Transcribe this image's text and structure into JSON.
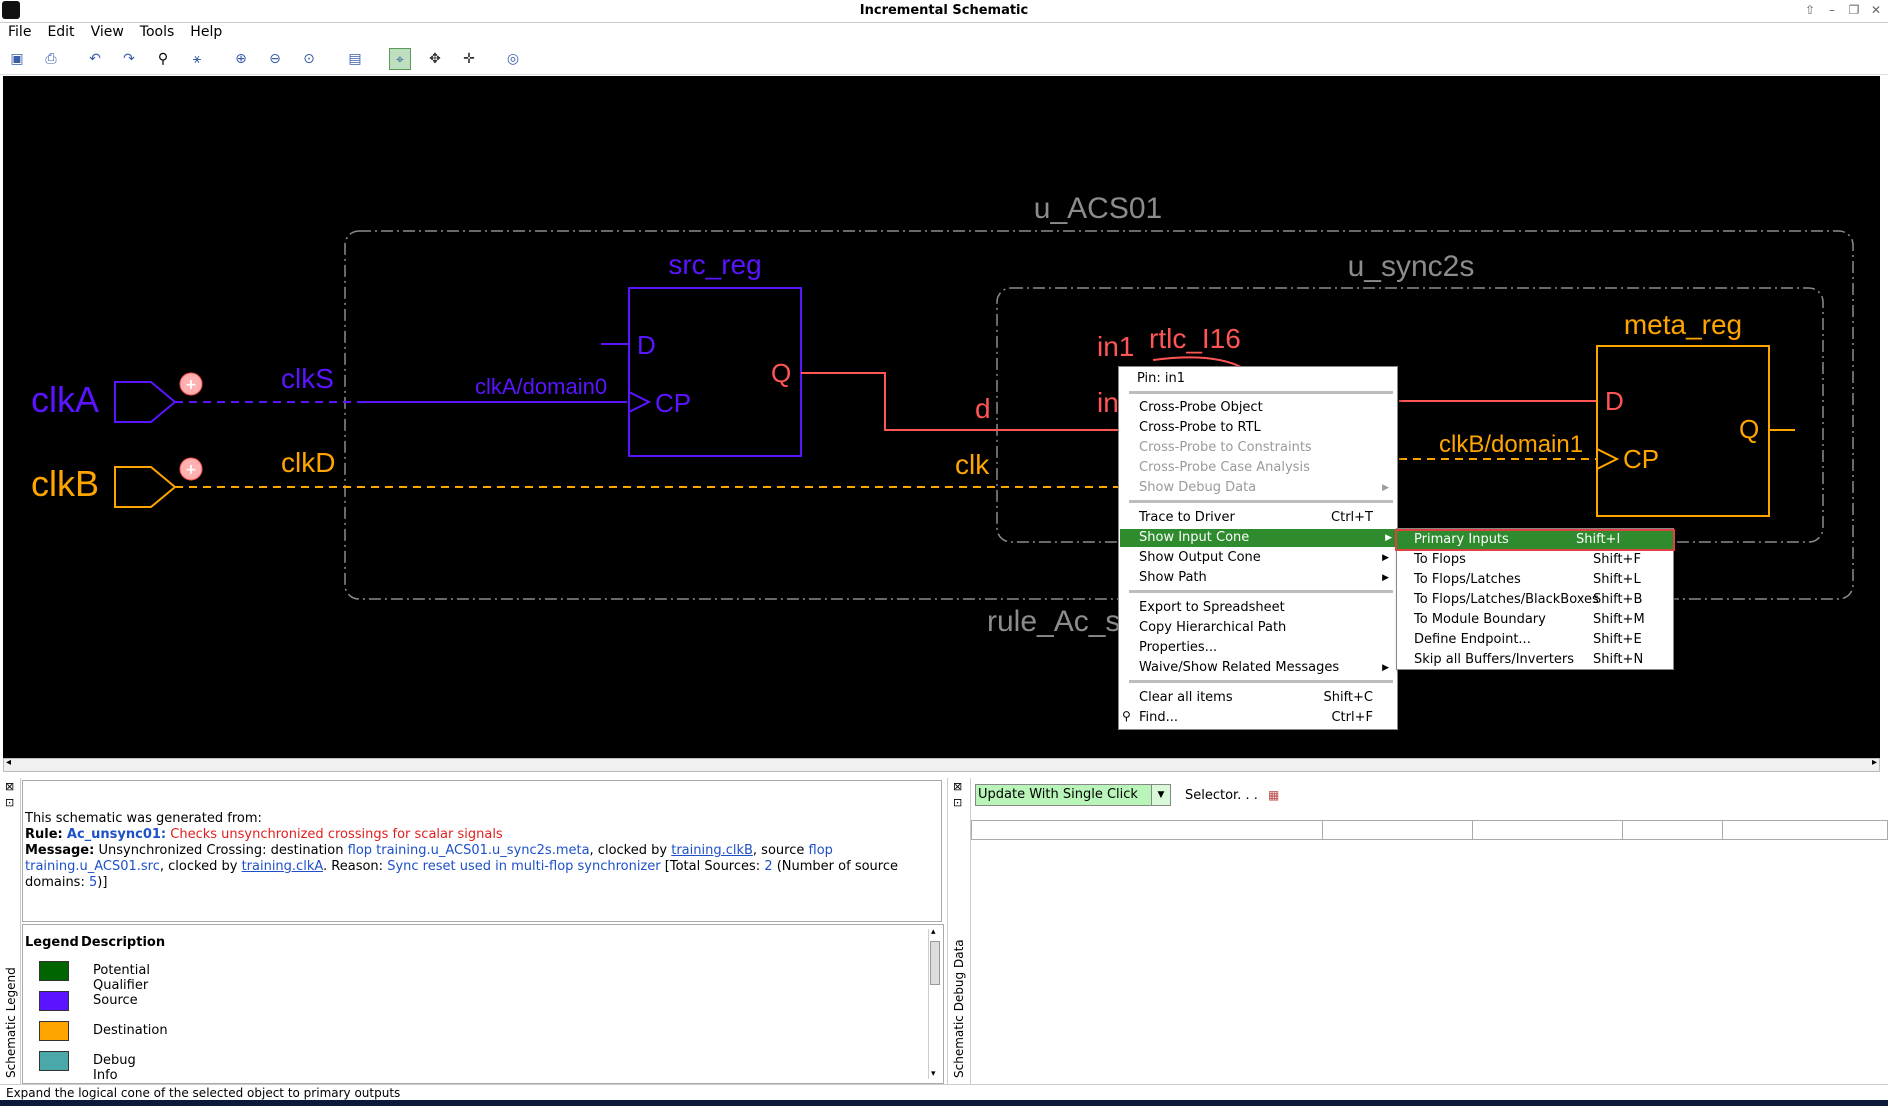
{
  "window": {
    "title": "Incremental Schematic"
  },
  "menu": [
    "File",
    "Edit",
    "View",
    "Tools",
    "Help"
  ],
  "colors": {
    "source": "#5a14ff",
    "destination": "#ffa500",
    "qualifier": "#006400",
    "debug": "#4aa8a8",
    "highlight": "#ff5555",
    "grey": "#8c8c8c"
  },
  "schematic": {
    "module_outer": "u_ACS01",
    "module_inner": "u_sync2s",
    "rule_label": "rule_Ac_s",
    "ports": [
      {
        "name": "clkA"
      },
      {
        "name": "clkB"
      }
    ],
    "nets": {
      "clkS": "clkS",
      "clkD": "clkD",
      "clkA_domain": "clkA/domain0",
      "clkB_domain": "clkB/domain1"
    },
    "src_reg": {
      "name": "src_reg",
      "pin_d": "D",
      "pin_cp": "CP",
      "pin_q": "Q"
    },
    "meta_reg": {
      "name": "meta_reg",
      "pin_d": "D",
      "pin_cp": "CP",
      "pin_q": "Q"
    },
    "inner_pins": {
      "d": "d",
      "clk": "clk",
      "in1": "in1",
      "in0": "in",
      "gate": "rtlc_I16"
    }
  },
  "context_menu": {
    "header": "Pin: in1",
    "items": [
      {
        "label": "Cross-Probe Object",
        "enabled": true
      },
      {
        "label": "Cross-Probe to RTL",
        "enabled": true
      },
      {
        "label": "Cross-Probe to Constraints",
        "enabled": false
      },
      {
        "label": "Cross-Probe Case Analysis",
        "enabled": false
      },
      {
        "label": "Show Debug Data",
        "enabled": false
      }
    ],
    "trace": {
      "label": "Trace to Driver",
      "shortcut": "Ctrl+T"
    },
    "show_input_cone": "Show Input Cone",
    "show_output_cone": "Show Output Cone",
    "show_path": "Show Path",
    "export": "Export to Spreadsheet",
    "copy_path": "Copy Hierarchical Path",
    "properties": "Properties...",
    "waive": "Waive/Show Related Messages",
    "clear": {
      "label": "Clear all items",
      "shortcut": "Shift+C"
    },
    "find": {
      "label": "Find...",
      "shortcut": "Ctrl+F"
    }
  },
  "submenu": [
    {
      "label": "Primary Inputs",
      "shortcut": "Shift+I"
    },
    {
      "label": "To Flops",
      "shortcut": "Shift+F"
    },
    {
      "label": "To Flops/Latches",
      "shortcut": "Shift+L"
    },
    {
      "label": "To Flops/Latches/BlackBoxes",
      "shortcut": "Shift+B"
    },
    {
      "label": "To Module Boundary",
      "shortcut": "Shift+M"
    },
    {
      "label": "Define Endpoint...",
      "shortcut": "Shift+E"
    },
    {
      "label": "Skip all Buffers/Inverters",
      "shortcut": "Shift+N"
    }
  ],
  "message": {
    "line1": "This schematic was generated from:",
    "rule_key": "Rule:",
    "rule_name": "Ac_unsync01:",
    "rule_desc": "Checks unsynchronized crossings for scalar signals",
    "msg_key": "Message:",
    "p1": "Unsynchronized Crossing: destination",
    "dest_flop": "flop training.u_ACS01.u_sync2s.meta",
    "p2": ", clocked by",
    "dest_clk": "training.clkB",
    "p3": ", source",
    "src_flop": "flop training.u_ACS01.src",
    "p4": ", clocked by",
    "src_clk": "training.clkA",
    "p5": ". Reason:",
    "reason": "Sync reset used in multi-flop synchronizer",
    "p6": "[Total Sources:",
    "total": "2",
    "p7": "(Number of source domains:",
    "domains": "5",
    "p8": ")]"
  },
  "legend": {
    "col_legend": "Legend",
    "col_desc": "Description",
    "rows": [
      {
        "desc": "Potential Qualifier",
        "color": "#006400"
      },
      {
        "desc": "Source",
        "color": "#5a14ff"
      },
      {
        "desc": "Destination",
        "color": "#ffa500"
      },
      {
        "desc": "Debug Info",
        "color": "#4aa8a8"
      }
    ],
    "tab_label": "Schematic Legend"
  },
  "debug_panel": {
    "tab_label": "Schematic Debug Data",
    "mode": "Update With Single Click",
    "selector": "Selector. . ."
  },
  "status": "Expand the logical cone of the selected object to primary outputs"
}
